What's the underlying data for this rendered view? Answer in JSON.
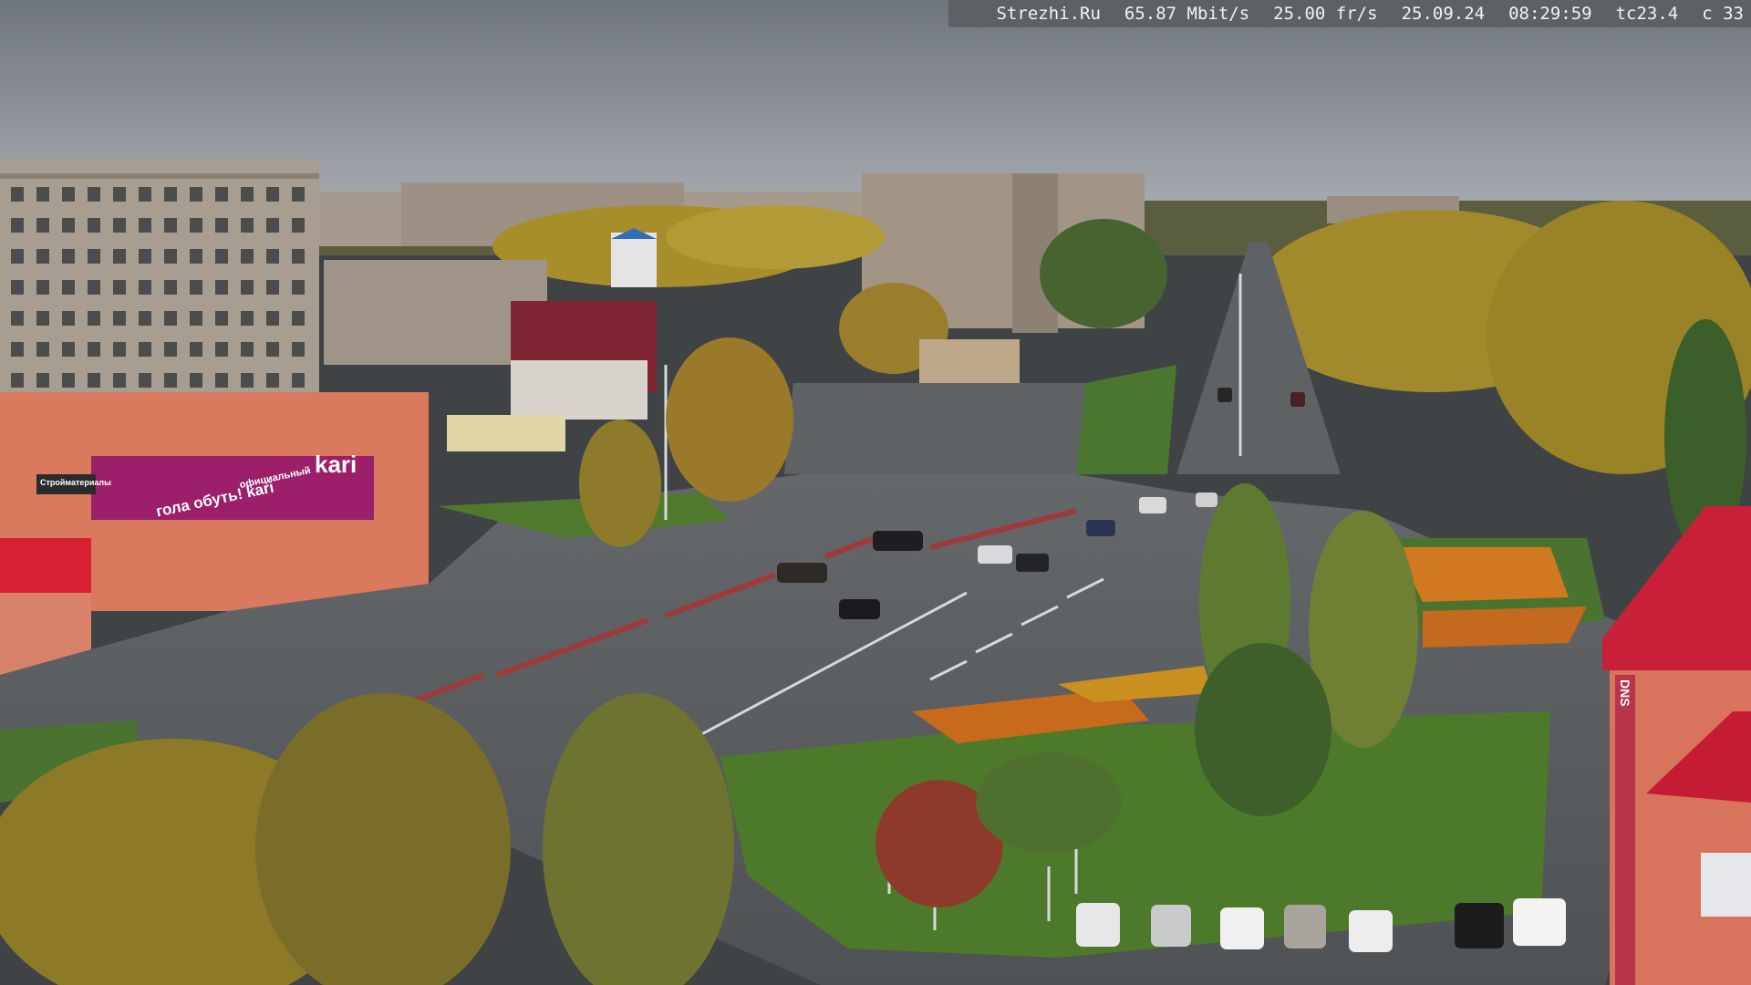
{
  "overlay": {
    "site": "Strezhi.Ru",
    "bitrate": "65.87 Mbit/s",
    "framerate": "25.00 fr/s",
    "date": "25.09.24",
    "time": "08:29:59",
    "temp": "tc23.4",
    "camera": "c 33"
  },
  "signs": {
    "store_brand": "kari",
    "store_facade": "гола обуть! kari",
    "banner_small": "официальный",
    "dns": "DNS",
    "left_red_sign": "Стройматериалы"
  },
  "colors": {
    "sky": "#9a9fa6",
    "asphalt": "#55585b",
    "grass": "#4f7a2e",
    "kari_magenta": "#9c1f6a",
    "roof_red": "#c9203a",
    "autumn_yellow": "#b89a2a"
  }
}
